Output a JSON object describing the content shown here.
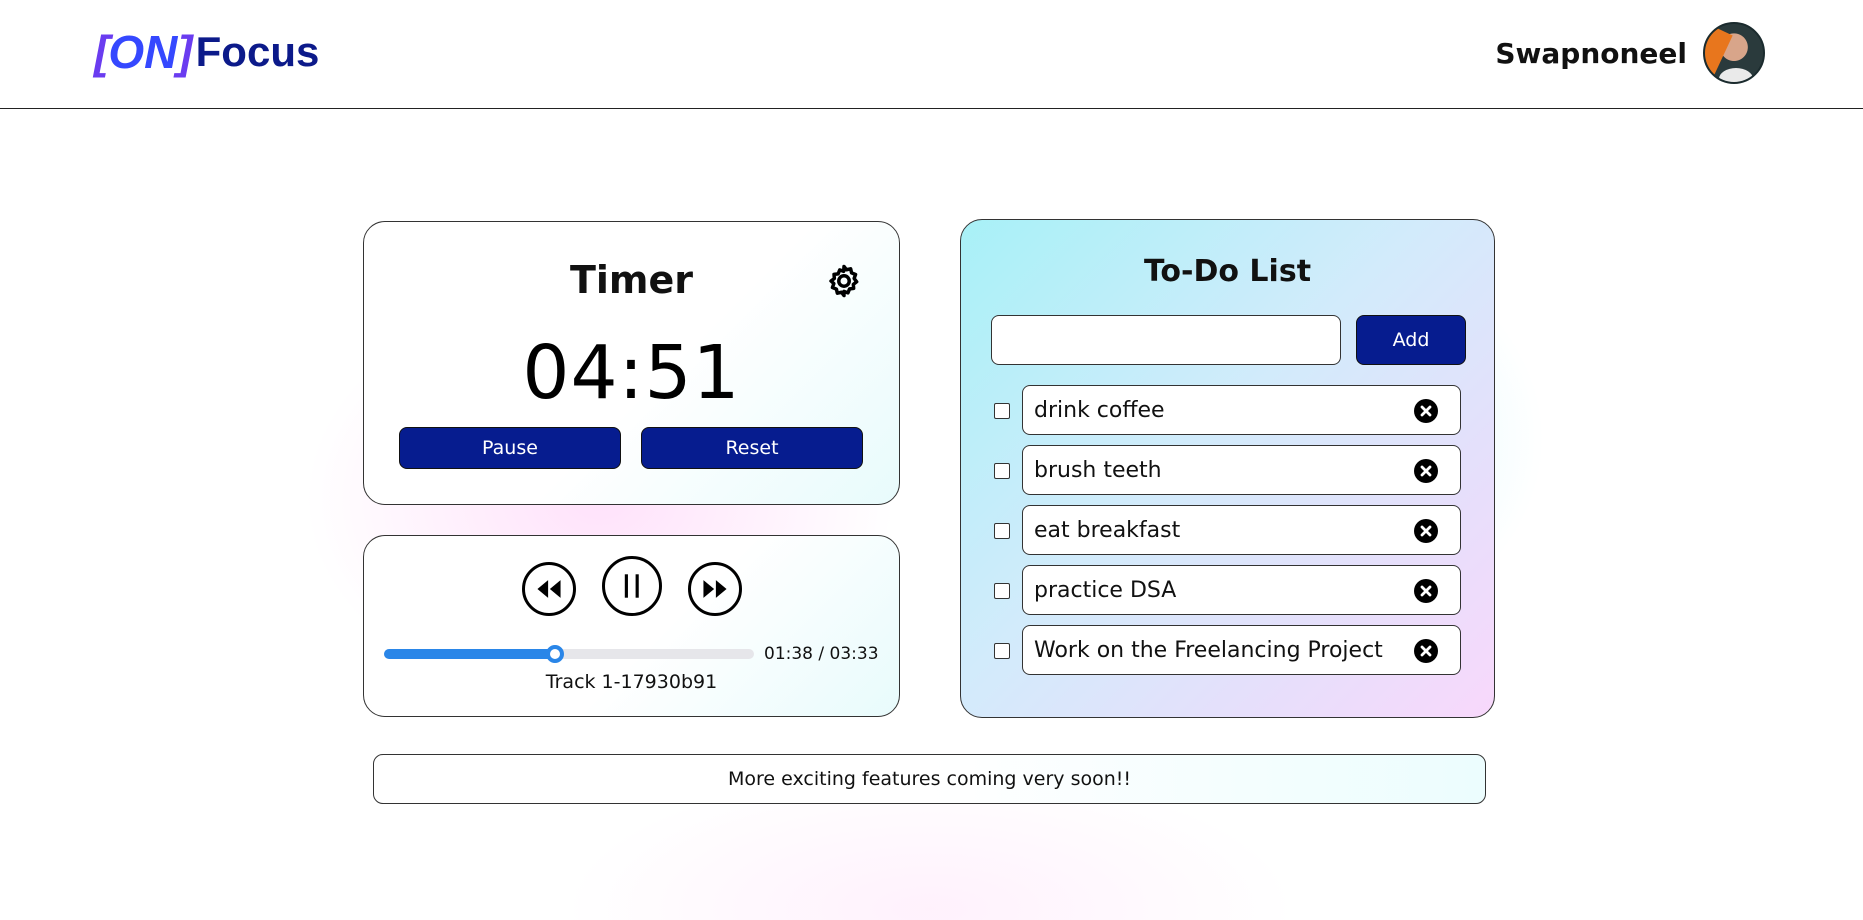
{
  "header": {
    "logo": {
      "bracket_open": "[",
      "on": "ON",
      "bracket_close": "]",
      "focus": "Focus"
    },
    "user": {
      "name": "Swapnoneel",
      "avatar_icon": "user-avatar"
    }
  },
  "timer": {
    "title": "Timer",
    "time": "04:51",
    "settings_icon": "gear-icon",
    "pause_label": "Pause",
    "reset_label": "Reset"
  },
  "player": {
    "prev_icon": "rewind-icon",
    "play_icon": "pause-icon",
    "next_icon": "fast-forward-icon",
    "progress_fraction": 0.463,
    "time_display": "01:38 / 03:33",
    "track_name": "Track 1-17930b91"
  },
  "todo": {
    "title": "To-Do List",
    "input_value": "",
    "add_label": "Add",
    "items": [
      {
        "text": "drink coffee",
        "checked": false
      },
      {
        "text": "brush teeth",
        "checked": false
      },
      {
        "text": "eat breakfast",
        "checked": false
      },
      {
        "text": "practice DSA",
        "checked": false
      },
      {
        "text": "Work on the Freelancing Project",
        "checked": false
      }
    ]
  },
  "banner": {
    "text": "More exciting features coming very soon!!"
  },
  "colors": {
    "primary_button": "#061c8f",
    "logo_dark": "#0c1a8a",
    "logo_accent": "#6a3cf0",
    "progress": "#2a86e8"
  }
}
